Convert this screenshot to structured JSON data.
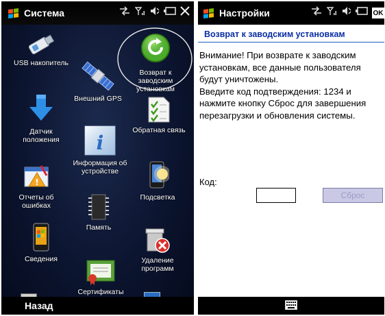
{
  "left": {
    "title": "Система",
    "bottom_softkey": "Назад",
    "apps": [
      {
        "label": "USB накопитель",
        "icon": "usb-drive-icon"
      },
      {
        "label": "Возврат к\nзаводским\nустановкам",
        "icon": "reset-refresh-icon"
      },
      {
        "label": "Внешний GPS",
        "icon": "satellite-icon"
      },
      {
        "label": "Датчик\nположения",
        "icon": "arrow-down-icon"
      },
      {
        "label": "Обратная связь",
        "icon": "checklist-icon"
      },
      {
        "label": "Информация об\nустройстве",
        "icon": "info-icon"
      },
      {
        "label": "Отчеты об\nошибках",
        "icon": "error-report-icon"
      },
      {
        "label": "Подсветка",
        "icon": "backlight-icon"
      },
      {
        "label": "Память",
        "icon": "memory-chip-icon"
      },
      {
        "label": "Сведения",
        "icon": "about-phone-icon"
      },
      {
        "label": "Удаление\nпрограмм",
        "icon": "remove-programs-icon"
      },
      {
        "label": "Сертификаты",
        "icon": "certificate-icon"
      }
    ]
  },
  "right": {
    "title": "Настройки",
    "ok_label": "OK",
    "header": "Возврат к заводским установкам",
    "warning_text": "Внимание! При возврате к заводским установкам, все данные пользователя будут уничтожены.\nВведите код подтверждения: 1234 и нажмите кнопку Сброс для завершения перезагрузки и обновления системы.",
    "code_label": "Код:",
    "code_value": "",
    "reset_button": "Сброс"
  },
  "colors": {
    "header_blue": "#0a2ea3",
    "disabled_button": "#c9c9e6"
  }
}
